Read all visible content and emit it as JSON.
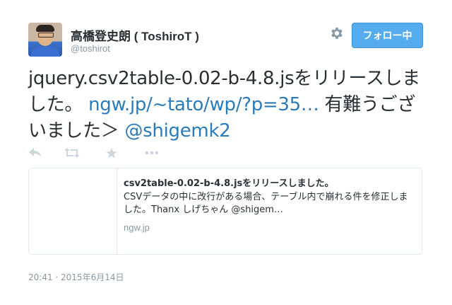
{
  "author": {
    "display_name": "高橋登史朗 ( ToshiroT )",
    "handle": "@toshirot",
    "avatar_icon": "avatar-photo"
  },
  "header": {
    "settings_icon": "gear-icon",
    "follow_label": "フォロー中"
  },
  "tweet": {
    "text_part1": "jquery.csv2table-0.02-b-4.8.jsをリリースしました。",
    "link_text": "ngw.jp/~tato/wp/?p=35…",
    "text_part2": "有難うございました＞",
    "mention": "@shigemk2"
  },
  "actions": {
    "reply_icon": "reply-icon",
    "retweet_icon": "retweet-icon",
    "favorite_icon": "star-icon",
    "more_icon": "more-icon"
  },
  "card": {
    "title": "csv2table-0.02-b-4.8.jsをリリースしました。",
    "description": "CSVデータの中に改行がある場合、テーブル内で崩れる件を修正しました。Thanx しげちゃん @shigem…",
    "domain": "ngw.jp"
  },
  "timestamp": "20:41 · 2015年6月14日",
  "colors": {
    "accent": "#55acee",
    "link": "#2b7bb9",
    "muted": "#8899a6",
    "text": "#292f33",
    "icon": "#ccd6dd"
  }
}
